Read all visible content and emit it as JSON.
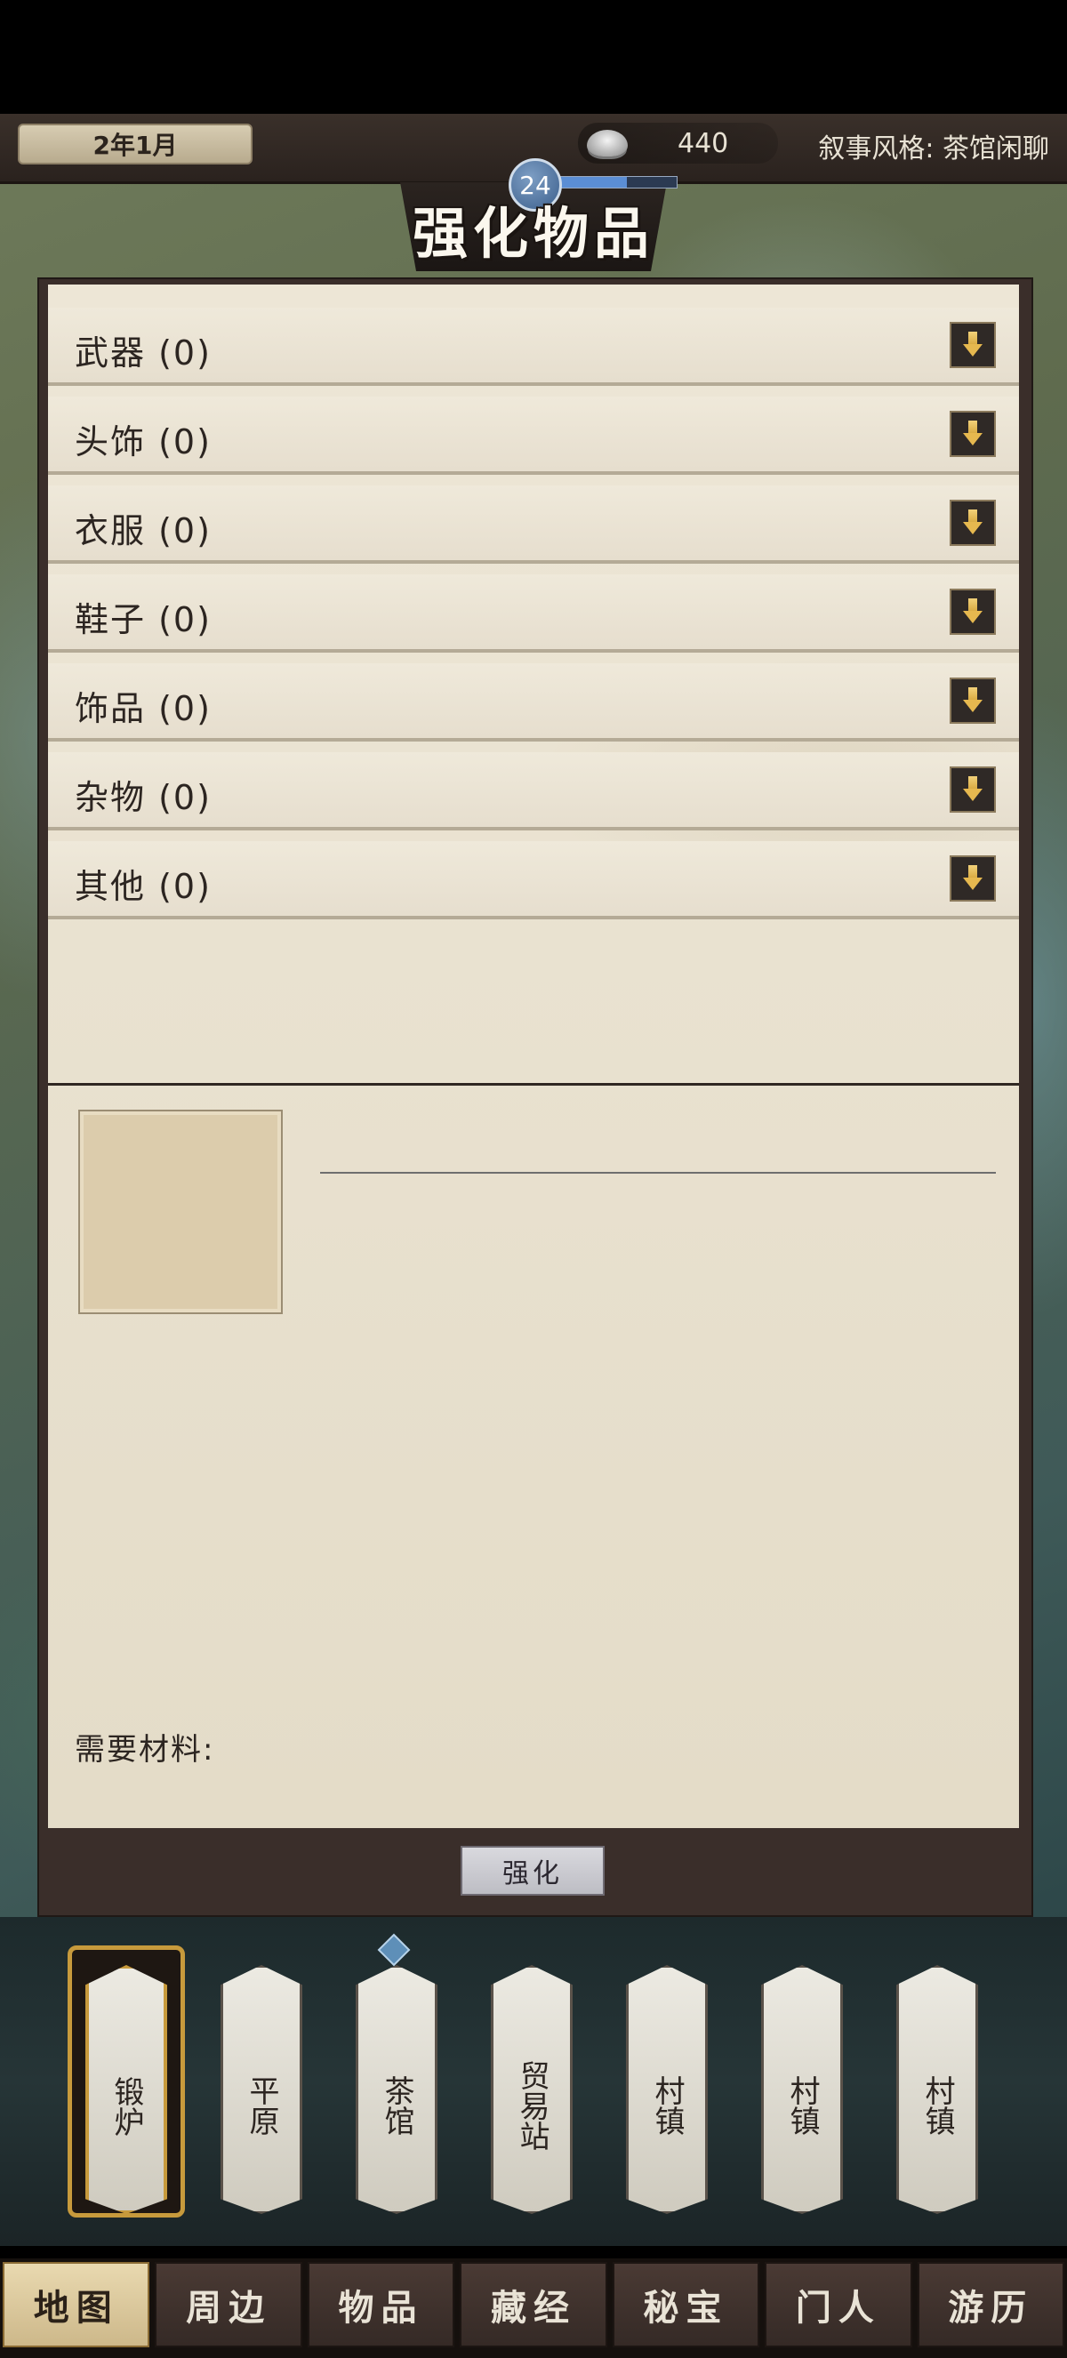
{
  "topbar": {
    "date": "2年1月",
    "currency_icon": "silver-ingot-icon",
    "currency_value": "440",
    "narrative_style": "叙事风格: 茶馆闲聊"
  },
  "title": {
    "text": "强化物品",
    "level": "24",
    "level_progress": 0.6
  },
  "categories": [
    {
      "label": "武器 (0)"
    },
    {
      "label": "头饰 (0)"
    },
    {
      "label": "衣服 (0)"
    },
    {
      "label": "鞋子 (0)"
    },
    {
      "label": "饰品 (0)"
    },
    {
      "label": "杂物 (0)"
    },
    {
      "label": "其他 (0)"
    }
  ],
  "detail": {
    "materials_label": "需要材料:"
  },
  "enhance_button": "强化",
  "locations": [
    {
      "label": "锻炉",
      "selected": true
    },
    {
      "label": "平原"
    },
    {
      "label": "茶馆",
      "marked": true
    },
    {
      "label": "贸易站"
    },
    {
      "label": "村镇"
    },
    {
      "label": "村镇"
    },
    {
      "label": "村镇"
    }
  ],
  "nav": [
    {
      "label": "地图",
      "active": true
    },
    {
      "label": "周边"
    },
    {
      "label": "物品"
    },
    {
      "label": "藏经"
    },
    {
      "label": "秘宝"
    },
    {
      "label": "门人"
    },
    {
      "label": "游历"
    }
  ],
  "colors": {
    "accent_gold": "#c79a3c",
    "panel_paper": "#ede6d6",
    "frame_dark": "#3a2e2a"
  }
}
